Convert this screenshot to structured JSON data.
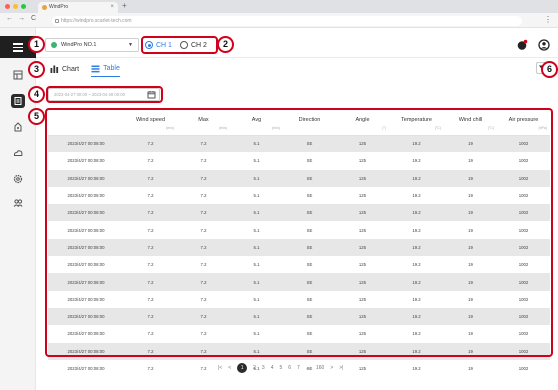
{
  "browser": {
    "tab_title": "WindPro",
    "tab_close": "×",
    "new_tab": "+",
    "url": "https://windpro.scarlet-tech.com",
    "menu": "⋮",
    "back": "←",
    "forward": "→",
    "reload": "C"
  },
  "toolbar": {
    "device_name": "WindPro NO.1",
    "device_caret": "▼",
    "channels": [
      {
        "label": "CH 1",
        "selected": true
      },
      {
        "label": "CH 2",
        "selected": false
      }
    ]
  },
  "view_tabs": [
    {
      "label": "Chart",
      "active": false
    },
    {
      "label": "Table",
      "active": true
    }
  ],
  "date_range": {
    "value": "2023-04-27 00:00 ~ 2023-04-28 00:00"
  },
  "table": {
    "columns": [
      {
        "label": "",
        "unit": ""
      },
      {
        "label": "Wind speed",
        "unit": "(m/s)"
      },
      {
        "label": "Max",
        "unit": "(m/s)"
      },
      {
        "label": "Avg",
        "unit": "(m/s)"
      },
      {
        "label": "Direction",
        "unit": ""
      },
      {
        "label": "Angle",
        "unit": "(°)"
      },
      {
        "label": "Temperature",
        "unit": "(°C)"
      },
      {
        "label": "Wind chill",
        "unit": "(°C)"
      },
      {
        "label": "Air pressure",
        "unit": "(hPa)"
      }
    ],
    "rows": [
      [
        "2023/4/27 00:08:00",
        "7.2",
        "7.2",
        "5.1",
        "SE",
        "125",
        "19.2",
        "19",
        "1002"
      ],
      [
        "2023/4/27 00:08:00",
        "7.2",
        "7.2",
        "5.1",
        "SE",
        "125",
        "19.2",
        "19",
        "1002"
      ],
      [
        "2023/4/27 00:08:00",
        "7.2",
        "7.2",
        "5.1",
        "SE",
        "125",
        "19.2",
        "19",
        "1002"
      ],
      [
        "2023/4/27 00:08:00",
        "7.2",
        "7.2",
        "5.1",
        "SE",
        "125",
        "19.2",
        "19",
        "1002"
      ],
      [
        "2023/4/27 00:08:00",
        "7.2",
        "7.2",
        "5.1",
        "SE",
        "125",
        "19.2",
        "19",
        "1002"
      ],
      [
        "2023/4/27 00:08:00",
        "7.2",
        "7.2",
        "5.1",
        "SE",
        "125",
        "19.2",
        "19",
        "1002"
      ],
      [
        "2023/4/27 00:08:00",
        "7.2",
        "7.2",
        "5.1",
        "SE",
        "125",
        "19.2",
        "19",
        "1002"
      ],
      [
        "2023/4/27 00:08:00",
        "7.2",
        "7.2",
        "5.1",
        "SE",
        "125",
        "19.2",
        "19",
        "1002"
      ],
      [
        "2023/4/27 00:08:00",
        "7.2",
        "7.2",
        "5.1",
        "SE",
        "125",
        "19.2",
        "19",
        "1002"
      ],
      [
        "2023/4/27 00:08:00",
        "7.2",
        "7.2",
        "5.1",
        "SE",
        "125",
        "19.2",
        "19",
        "1002"
      ],
      [
        "2023/4/27 00:08:00",
        "7.2",
        "7.2",
        "5.1",
        "SE",
        "125",
        "19.2",
        "19",
        "1002"
      ],
      [
        "2023/4/27 00:08:00",
        "7.2",
        "7.2",
        "5.1",
        "SE",
        "125",
        "19.2",
        "19",
        "1002"
      ],
      [
        "2023/4/27 00:08:00",
        "7.2",
        "7.2",
        "5.1",
        "SE",
        "125",
        "19.2",
        "19",
        "1002"
      ],
      [
        "2023/4/27 00:08:00",
        "7.2",
        "7.2",
        "5.1",
        "SE",
        "125",
        "19.2",
        "19",
        "1002"
      ]
    ]
  },
  "pagination": {
    "first": "|<",
    "prev": "<",
    "pages": [
      "1",
      "2",
      "3",
      "4",
      "5",
      "6",
      "7"
    ],
    "current": "1",
    "ellipsis": "...",
    "last_page": "160",
    "next": ">",
    "last": ">|"
  },
  "callouts": [
    "1",
    "2",
    "3",
    "4",
    "5",
    "6"
  ],
  "icons": {
    "sidebar": [
      "menu-icon",
      "dashboard-icon",
      "history-icon",
      "station-icon",
      "weather-icon",
      "settings-icon",
      "users-icon"
    ],
    "toolbar": [
      "notification-icon",
      "account-icon",
      "filter-icon",
      "calendar-icon",
      "bar-chart-icon",
      "table-icon"
    ]
  },
  "colors": {
    "accent": "#2f7fe0",
    "callout": "#d0021b",
    "status_online": "#3cb371",
    "sidebar_active": "#2b2b2b",
    "row_stripe": "#e7e7e7"
  }
}
